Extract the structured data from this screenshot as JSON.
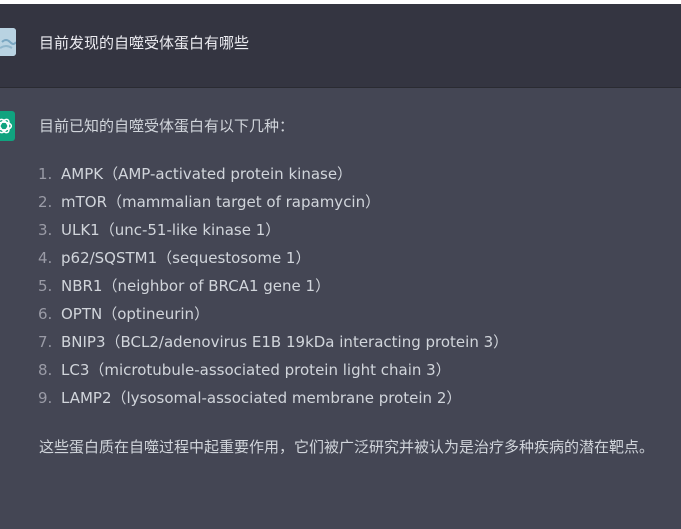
{
  "user_message": {
    "text": "目前发现的自噬受体蛋白有哪些",
    "avatar": "user-avatar-icon"
  },
  "assistant_message": {
    "avatar": "openai-logo-icon",
    "intro": "目前已知的自噬受体蛋白有以下几种：",
    "items": [
      {
        "num": "1.",
        "text": "AMPK（AMP-activated protein kinase）"
      },
      {
        "num": "2.",
        "text": "mTOR（mammalian target of rapamycin）"
      },
      {
        "num": "3.",
        "text": "ULK1（unc-51-like kinase 1）"
      },
      {
        "num": "4.",
        "text": "p62/SQSTM1（sequestosome 1）"
      },
      {
        "num": "5.",
        "text": "NBR1（neighbor of BRCA1 gene 1）"
      },
      {
        "num": "6.",
        "text": "OPTN（optineurin）"
      },
      {
        "num": "7.",
        "text": "BNIP3（BCL2/adenovirus E1B 19kDa interacting protein 3）"
      },
      {
        "num": "8.",
        "text": "LC3（microtubule-associated protein light chain 3）"
      },
      {
        "num": "9.",
        "text": "LAMP2（lysosomal-associated membrane protein 2）"
      }
    ],
    "outro": "这些蛋白质在自噬过程中起重要作用，它们被广泛研究并被认为是治疗多种疾病的潜在靶点。"
  },
  "colors": {
    "user_bg": "#343541",
    "assistant_bg": "#444654",
    "bot_avatar": "#10a37f",
    "text": "#d1d5db"
  }
}
